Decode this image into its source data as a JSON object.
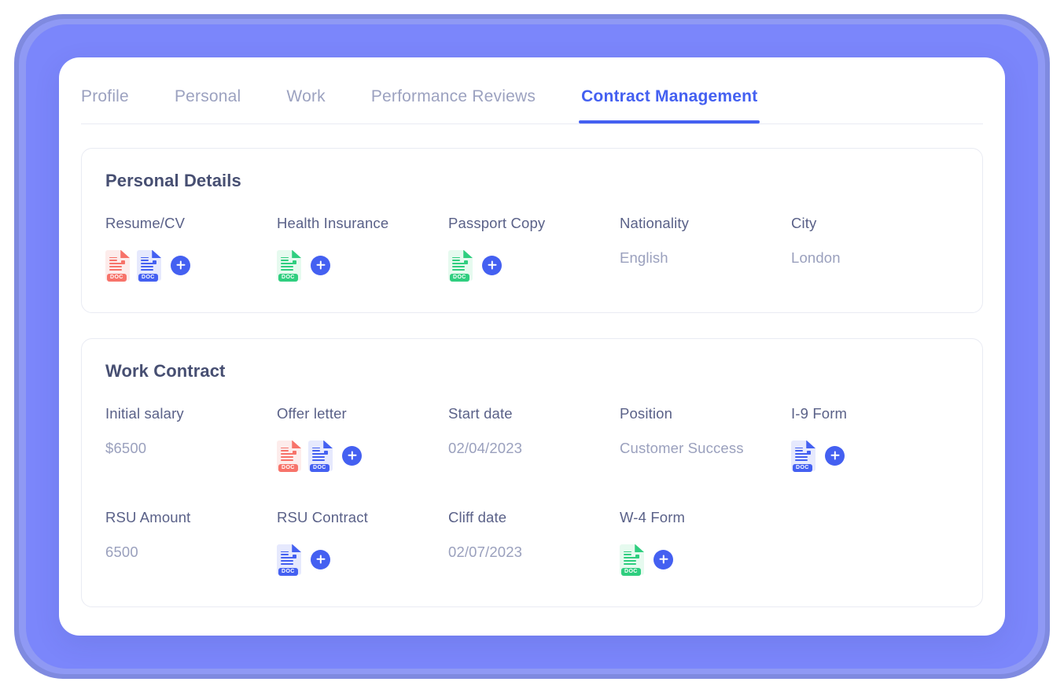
{
  "tabs": [
    {
      "label": "Profile",
      "active": false
    },
    {
      "label": "Personal",
      "active": false
    },
    {
      "label": "Work",
      "active": false
    },
    {
      "label": "Performance Reviews",
      "active": false
    },
    {
      "label": "Contract Management",
      "active": true
    }
  ],
  "colors": {
    "accent": "#4460f1",
    "frame": "#7b86fb",
    "frame_mid": "#8f99f4",
    "frame_outer": "#7f8ae0",
    "label_text": "#5a6188",
    "value_text": "#9aa0bd",
    "title_text": "#474f72",
    "tab_inactive": "#9ca2c0",
    "doc_red": "#f7736a",
    "doc_blue": "#4460f1",
    "doc_green": "#2fce7f",
    "panel_border": "#e9ebf3"
  },
  "icons": {
    "add": "plus-icon",
    "doc": "document-icon",
    "doc_badge_label": "DOC"
  },
  "panels": [
    {
      "title": "Personal Details",
      "rows": [
        [
          {
            "label": "Resume/CV",
            "type": "docs",
            "docs": [
              "red",
              "blue"
            ],
            "add": true
          },
          {
            "label": "Health Insurance",
            "type": "docs",
            "docs": [
              "green"
            ],
            "add": true
          },
          {
            "label": "Passport Copy",
            "type": "docs",
            "docs": [
              "green"
            ],
            "add": true
          },
          {
            "label": "Nationality",
            "type": "value",
            "value": "English"
          },
          {
            "label": "City",
            "type": "value",
            "value": "London"
          }
        ]
      ]
    },
    {
      "title": "Work Contract",
      "rows": [
        [
          {
            "label": "Initial salary",
            "type": "value",
            "value": "$6500"
          },
          {
            "label": "Offer letter",
            "type": "docs",
            "docs": [
              "red",
              "blue"
            ],
            "add": true
          },
          {
            "label": "Start date",
            "type": "value",
            "value": "02/04/2023"
          },
          {
            "label": "Position",
            "type": "value",
            "value": "Customer Success"
          },
          {
            "label": "I-9 Form",
            "type": "docs",
            "docs": [
              "blue"
            ],
            "add": true
          }
        ],
        [
          {
            "label": "RSU Amount",
            "type": "value",
            "value": "6500"
          },
          {
            "label": "RSU Contract",
            "type": "docs",
            "docs": [
              "blue"
            ],
            "add": true
          },
          {
            "label": "Cliff date",
            "type": "value",
            "value": "02/07/2023"
          },
          {
            "label": "W-4 Form",
            "type": "docs",
            "docs": [
              "green"
            ],
            "add": true
          },
          {
            "label": "",
            "type": "empty"
          }
        ]
      ]
    }
  ]
}
